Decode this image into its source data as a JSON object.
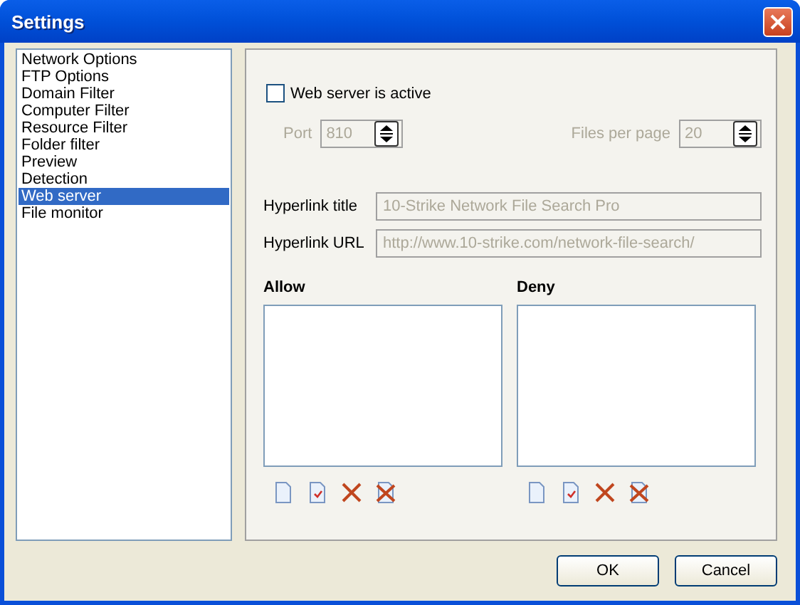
{
  "window": {
    "title": "Settings"
  },
  "sidebar": {
    "items": [
      {
        "label": "Network Options",
        "selected": false
      },
      {
        "label": "FTP Options",
        "selected": false
      },
      {
        "label": "Domain Filter",
        "selected": false
      },
      {
        "label": "Computer Filter",
        "selected": false
      },
      {
        "label": "Resource Filter",
        "selected": false
      },
      {
        "label": "Folder filter",
        "selected": false
      },
      {
        "label": "Preview",
        "selected": false
      },
      {
        "label": "Detection",
        "selected": false
      },
      {
        "label": "Web server",
        "selected": true
      },
      {
        "label": "File monitor",
        "selected": false
      }
    ]
  },
  "web_server": {
    "active": {
      "label": "Web server is active",
      "checked": false
    },
    "port": {
      "label": "Port",
      "value": "810",
      "disabled": true
    },
    "files_per_page": {
      "label": "Files per page",
      "value": "20",
      "disabled": true
    },
    "hyperlink_title": {
      "label": "Hyperlink title",
      "value": "10-Strike Network File Search Pro",
      "disabled": true
    },
    "hyperlink_url": {
      "label": "Hyperlink URL",
      "value": "http://www.10-strike.com/network-file-search/",
      "disabled": true
    },
    "lists": [
      {
        "title": "Allow"
      },
      {
        "title": "Deny"
      }
    ]
  },
  "buttons": [
    {
      "label": "OK"
    },
    {
      "label": "Cancel"
    }
  ]
}
